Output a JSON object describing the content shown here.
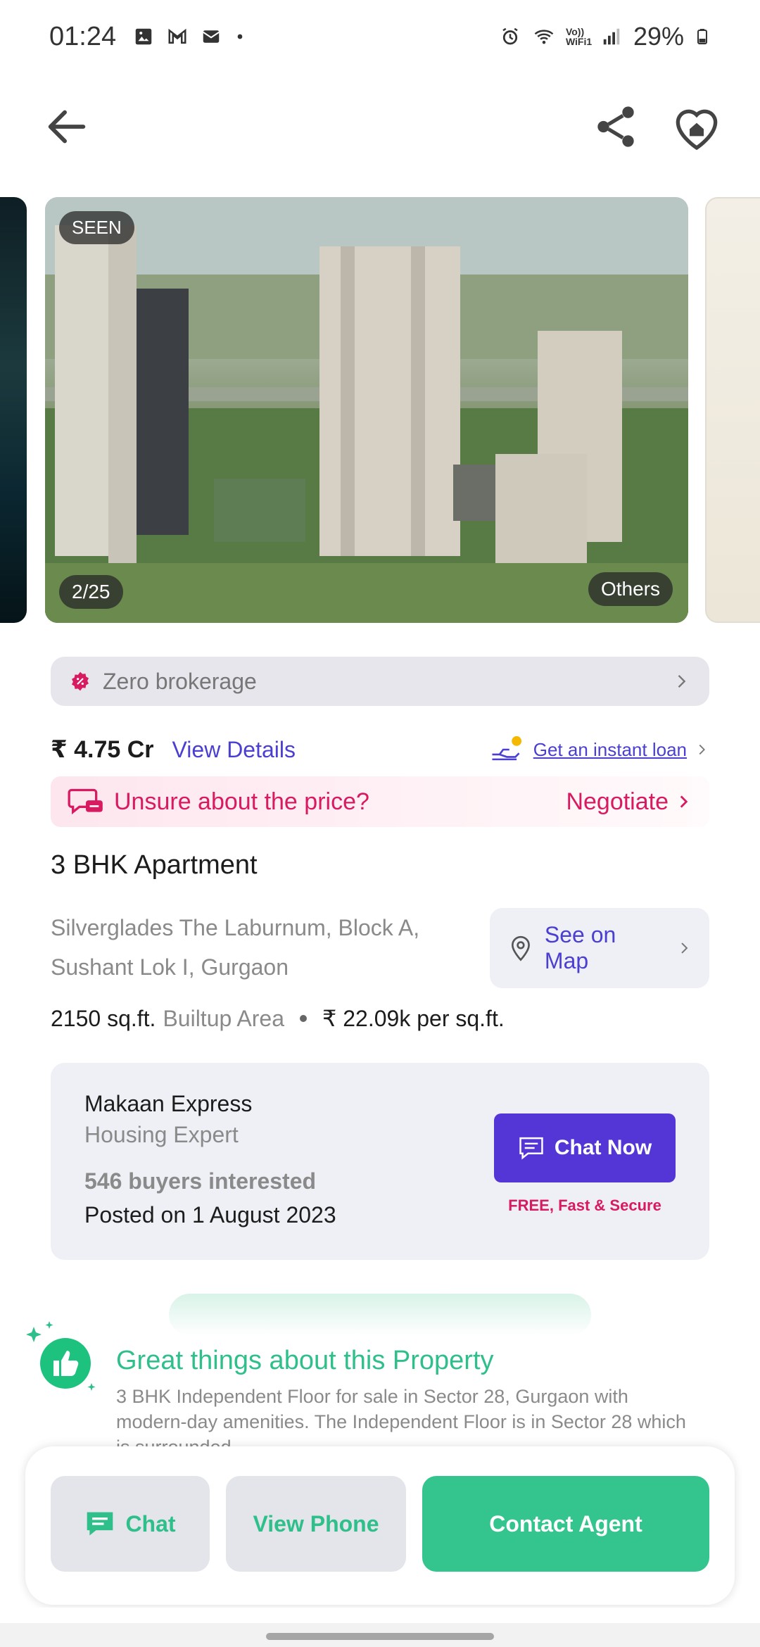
{
  "status_bar": {
    "time": "01:24",
    "battery": "29%",
    "notification_icons": [
      "image-icon",
      "gmail-icon",
      "mail-icon",
      "dot-icon"
    ],
    "system_icons": [
      "alarm-icon",
      "wifi-icon",
      "vowifi-icon",
      "signal-icon",
      "battery-icon"
    ],
    "vowifi_label": "Vo)) WiFi1"
  },
  "app_bar": {
    "back": "back-arrow-icon",
    "share": "share-icon",
    "favorite": "heart-home-icon"
  },
  "gallery": {
    "seen_badge": "SEEN",
    "counter": "2/25",
    "category": "Others"
  },
  "zero_brokerage": {
    "label": "Zero brokerage"
  },
  "price": {
    "amount": "₹ 4.75 Cr",
    "view_details": "View Details",
    "loan_link": "Get an instant loan"
  },
  "negotiate": {
    "question": "Unsure about the price?",
    "action": "Negotiate"
  },
  "property": {
    "title": "3 BHK Apartment",
    "address_line1": "Silverglades The Laburnum, Block A,",
    "address_line2": "Sushant Lok I, Gurgaon",
    "map_label": "See on Map",
    "area_value": "2150 sq.ft.",
    "area_type": "Builtup Area",
    "rate": "₹ 22.09k per sq.ft."
  },
  "agent": {
    "name": "Makaan Express",
    "role": "Housing Expert",
    "buyers": "546 buyers interested",
    "posted": "Posted on 1 August 2023",
    "chat_label": "Chat Now",
    "free_note": "FREE, Fast & Secure"
  },
  "highlights": {
    "title": "Great things about this Property",
    "description": "3 BHK Independent Floor for sale in Sector 28, Gurgaon with modern-day amenities. The Independent Floor is in Sector 28 which is surrounded..."
  },
  "actions": {
    "chat": "Chat",
    "view_phone": "View Phone",
    "contact_agent": "Contact Agent"
  },
  "colors": {
    "primary_purple": "#5436d6",
    "accent_green": "#33c58d",
    "negotiate_pink": "#d81b60",
    "link_blue": "#4a3fd0"
  }
}
